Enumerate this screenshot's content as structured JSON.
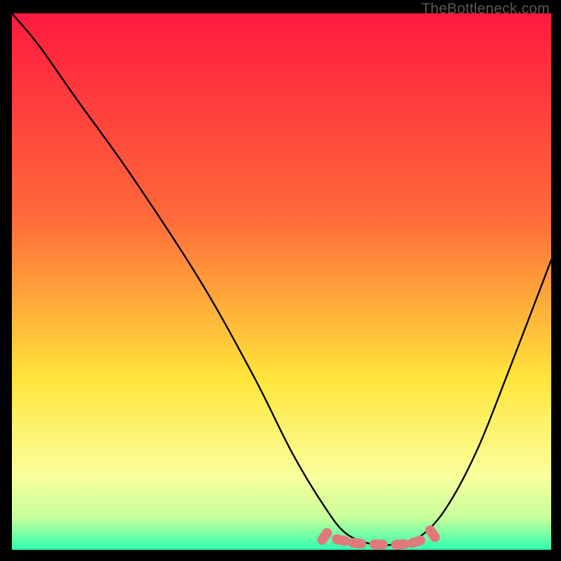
{
  "watermark": "TheBottleneck.com",
  "colors": {
    "grad_top": "#ff1a3f",
    "grad_mid1": "#ff6a3a",
    "grad_mid2": "#ffe53a",
    "grad_mid3": "#faff9c",
    "grad_bottom1": "#c8ff9c",
    "grad_bottom2": "#2dffb0",
    "curve": "#000000",
    "marker": "#e07a7a"
  },
  "chart_data": {
    "type": "line",
    "title": "",
    "xlabel": "",
    "ylabel": "",
    "xlim": [
      0,
      100
    ],
    "ylim": [
      0,
      100
    ],
    "series": [
      {
        "name": "curve",
        "x": [
          0,
          5,
          12,
          22,
          35,
          45,
          52,
          58,
          62,
          67,
          71,
          75,
          80,
          86,
          92,
          100
        ],
        "y": [
          100,
          94,
          84,
          70,
          50,
          32,
          18,
          8,
          3,
          1,
          1,
          2,
          7,
          18,
          33,
          54
        ]
      },
      {
        "name": "bottom-markers",
        "x": [
          58,
          61,
          64,
          68,
          72,
          75,
          78
        ],
        "y": [
          2.5,
          1.8,
          1.2,
          1.0,
          1.0,
          1.5,
          3.0
        ]
      }
    ]
  }
}
